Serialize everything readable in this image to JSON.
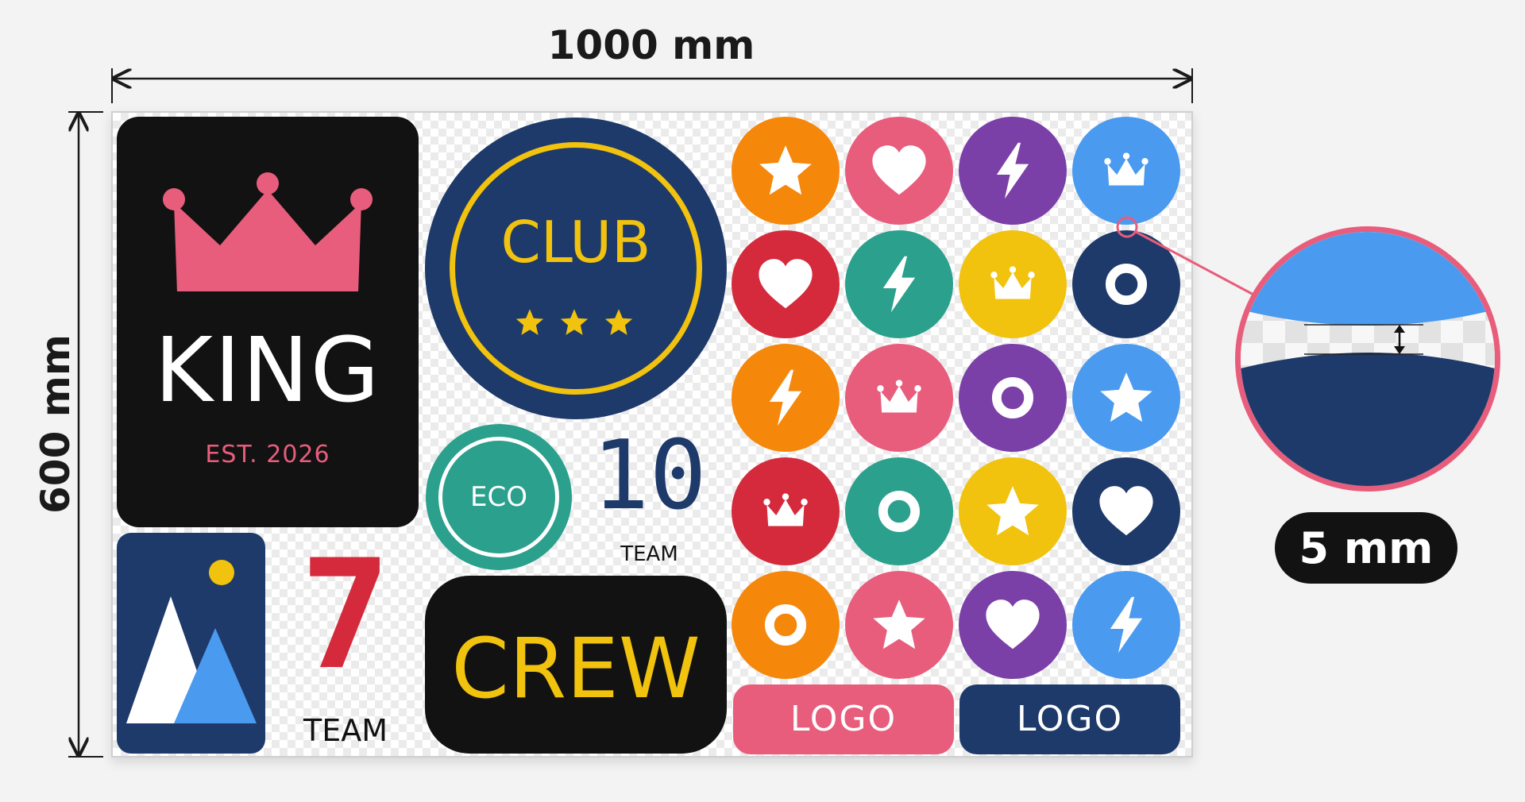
{
  "dimensions": {
    "width_label": "1000 mm",
    "height_label": "600 mm",
    "gap_label": "5 mm"
  },
  "stickers": {
    "king": {
      "title": "KING",
      "subtitle": "EST. 2026",
      "icon": "crown-icon"
    },
    "mountain": {
      "icon": "mountain-icon"
    },
    "seven": {
      "number": "7",
      "label": "TEAM"
    },
    "club": {
      "title": "CLUB",
      "stars": 3
    },
    "eco": {
      "label": "ECO"
    },
    "ten": {
      "number": "10",
      "label": "TEAM"
    },
    "crew": {
      "title": "CREW"
    },
    "logo_pink": {
      "label": "LOGO"
    },
    "logo_navy": {
      "label": "LOGO"
    }
  },
  "icon_grid": [
    [
      {
        "color": "#f5870b",
        "icon": "star-icon"
      },
      {
        "color": "#e85d7c",
        "icon": "heart-icon"
      },
      {
        "color": "#7b3fa8",
        "icon": "bolt-icon"
      },
      {
        "color": "#4a9aef",
        "icon": "crown-icon"
      }
    ],
    [
      {
        "color": "#d42a3c",
        "icon": "heart-icon"
      },
      {
        "color": "#2aa08d",
        "icon": "bolt-icon"
      },
      {
        "color": "#f1c20e",
        "icon": "crown-icon"
      },
      {
        "color": "#1e3a6a",
        "icon": "ring-icon"
      }
    ],
    [
      {
        "color": "#f5870b",
        "icon": "bolt-icon"
      },
      {
        "color": "#e85d7c",
        "icon": "crown-icon"
      },
      {
        "color": "#7b3fa8",
        "icon": "ring-icon"
      },
      {
        "color": "#4a9aef",
        "icon": "star-icon"
      }
    ],
    [
      {
        "color": "#d42a3c",
        "icon": "crown-icon"
      },
      {
        "color": "#2aa08d",
        "icon": "ring-icon"
      },
      {
        "color": "#f1c20e",
        "icon": "star-icon"
      },
      {
        "color": "#1e3a6a",
        "icon": "heart-icon"
      }
    ],
    [
      {
        "color": "#f5870b",
        "icon": "ring-icon"
      },
      {
        "color": "#e85d7c",
        "icon": "star-icon"
      },
      {
        "color": "#7b3fa8",
        "icon": "heart-icon"
      },
      {
        "color": "#4a9aef",
        "icon": "bolt-icon"
      }
    ]
  ],
  "colors": {
    "dark": "#121212",
    "navy": "#1e3a6a",
    "pink": "#e85d7c",
    "red": "#d42a3c",
    "yellow": "#f1c20e",
    "teal": "#2aa08d",
    "orange": "#f5870b",
    "purple": "#7b3fa8",
    "blue": "#4a9aef"
  }
}
